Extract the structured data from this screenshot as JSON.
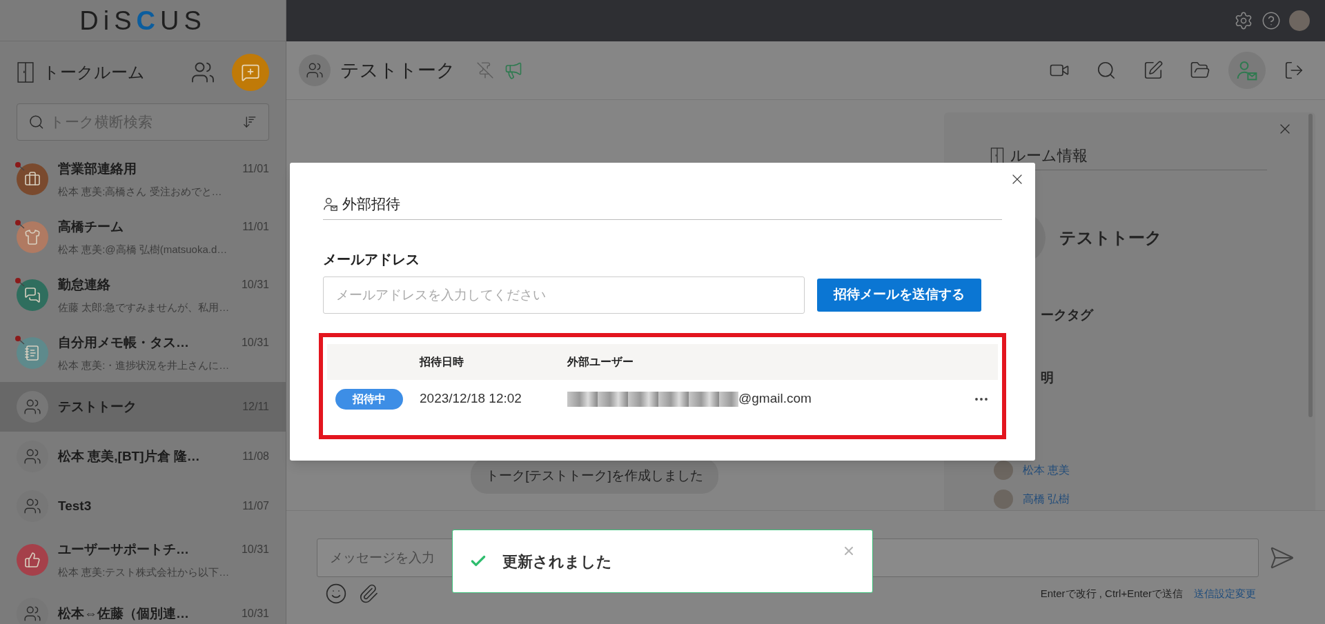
{
  "logo": [
    {
      "text": "DiS",
      "accent": false
    },
    {
      "text": "C",
      "accent": true
    },
    {
      "text": "US",
      "accent": false
    }
  ],
  "sidebar": {
    "title": "トークルーム",
    "search": {
      "placeholder": "トーク横断検索"
    },
    "items": [
      {
        "name": "営業部連絡用",
        "date": "11/01",
        "preview": "松本 恵美:高橋さん 受注おめでと…",
        "kind": "briefcase",
        "color": "#7a4a2e",
        "unread": true,
        "selected": false
      },
      {
        "name": "高橋チーム",
        "date": "11/01",
        "preview": "松本 恵美:@高橋 弘樹(matsuoka.d…",
        "kind": "tie",
        "color": "#b07a62",
        "unread": true,
        "selected": false
      },
      {
        "name": "勤怠連絡",
        "date": "10/31",
        "preview": "佐藤 太郎:急ですみませんが、私用…",
        "kind": "chat",
        "color": "#2f6e5e",
        "unread": true,
        "selected": false
      },
      {
        "name": "自分用メモ帳・タス…",
        "date": "10/31",
        "preview": "松本 恵美:・進捗状況を井上さんに…",
        "kind": "notepad",
        "color": "#5e8a8c",
        "unread": true,
        "selected": false
      },
      {
        "name": "テストトーク",
        "date": "12/11",
        "kind": "group",
        "color": "#777777",
        "unread": false,
        "selected": true
      },
      {
        "name": "松本 恵美,[BT]片倉 隆…",
        "date": "11/08",
        "kind": "group",
        "color": "#777777",
        "unread": false,
        "selected": false
      },
      {
        "name": "Test3",
        "date": "11/07",
        "kind": "group",
        "color": "#777777",
        "unread": false,
        "selected": false
      },
      {
        "name": "ユーザーサポートチ…",
        "date": "10/31",
        "preview": "松本 恵美:テスト株式会社から以下…",
        "kind": "thumbs-up",
        "color": "#a5404a",
        "unread": false,
        "selected": false
      },
      {
        "name": "松本⇔佐藤（個別連…",
        "date": "10/31",
        "kind": "group",
        "color": "#777777",
        "unread": false,
        "selected": false
      }
    ]
  },
  "chat": {
    "title": "テストトーク",
    "pinned": false,
    "announce": true,
    "toolbar": [
      {
        "kind": "video",
        "selected": false
      },
      {
        "kind": "search",
        "selected": false
      },
      {
        "kind": "edit",
        "selected": false
      },
      {
        "kind": "folder",
        "selected": false
      },
      {
        "kind": "invite",
        "selected": true
      },
      {
        "kind": "exit",
        "selected": false
      }
    ],
    "system_message": "トーク[テストトーク]を作成しました",
    "composer": {
      "placeholder": "メッセージを入力",
      "hint": "Enterで改行 , Ctrl+Enterで送信",
      "settings_link": "送信設定変更"
    }
  },
  "room_info": {
    "title": "ルーム情報",
    "room_name": "テストトーク",
    "tag_label": "ークタグ",
    "description_label": "明",
    "members": [
      "松本 恵美",
      "高橋 弘樹"
    ]
  },
  "invite_dialog": {
    "title": "外部招待",
    "email_label": "メールアドレス",
    "email_placeholder": "メールアドレスを入力してください",
    "send_button": "招待メールを送信する",
    "columns": [
      "招待日時",
      "外部ユーザー"
    ],
    "rows": [
      {
        "status": "招待中",
        "date": "2023/12/18 12:02",
        "email": "@gmail.com",
        "redacted": true
      }
    ]
  },
  "toast": {
    "message": "更新されました"
  }
}
